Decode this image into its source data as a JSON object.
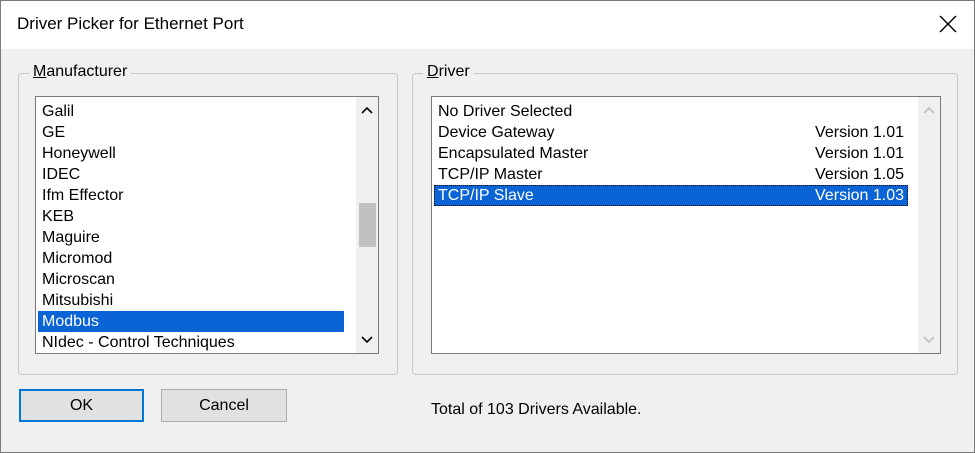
{
  "window": {
    "title": "Driver Picker for Ethernet Port",
    "close_icon": "close-icon"
  },
  "manufacturer": {
    "label_accel": "M",
    "label_rest": "anufacturer",
    "items": [
      {
        "label": "Galil",
        "selected": false
      },
      {
        "label": "GE",
        "selected": false
      },
      {
        "label": "Honeywell",
        "selected": false
      },
      {
        "label": "IDEC",
        "selected": false
      },
      {
        "label": "Ifm Effector",
        "selected": false
      },
      {
        "label": "KEB",
        "selected": false
      },
      {
        "label": "Maguire",
        "selected": false
      },
      {
        "label": "Micromod",
        "selected": false
      },
      {
        "label": "Microscan",
        "selected": false
      },
      {
        "label": "Mitsubishi",
        "selected": false
      },
      {
        "label": "Modbus",
        "selected": true
      },
      {
        "label": "NIdec - Control Techniques",
        "selected": false
      }
    ]
  },
  "driver": {
    "label_accel": "D",
    "label_rest": "river",
    "items": [
      {
        "name": "No Driver Selected",
        "version": "",
        "selected": false
      },
      {
        "name": "Device Gateway",
        "version": "Version 1.01",
        "selected": false
      },
      {
        "name": "Encapsulated Master",
        "version": "Version 1.01",
        "selected": false
      },
      {
        "name": "TCP/IP Master",
        "version": "Version 1.05",
        "selected": false
      },
      {
        "name": "TCP/IP Slave",
        "version": "Version 1.03",
        "selected": true
      }
    ]
  },
  "buttons": {
    "ok_label": "OK",
    "cancel_label": "Cancel"
  },
  "status": {
    "text": "Total of 103 Drivers Available."
  },
  "colors": {
    "selection": "#0a64d6",
    "default_button_border": "#0078d7"
  }
}
